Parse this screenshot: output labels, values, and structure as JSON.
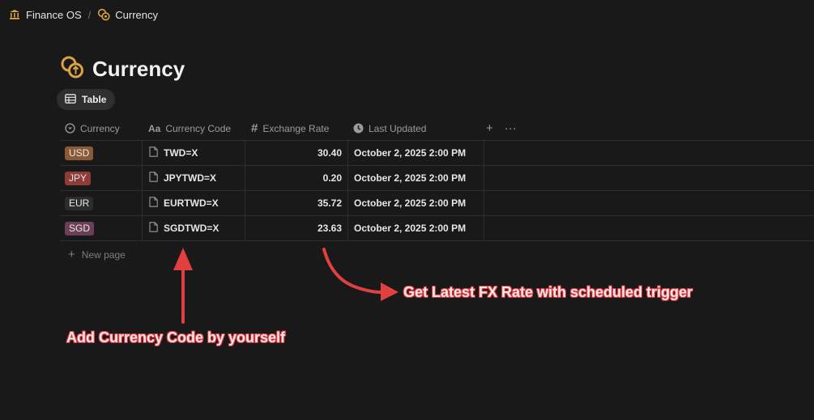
{
  "breadcrumb": {
    "workspace": "Finance OS",
    "separator": "/",
    "page": "Currency"
  },
  "page": {
    "title": "Currency"
  },
  "view_tab": {
    "label": "Table"
  },
  "columns": [
    {
      "label": "Currency",
      "icon": "select-icon"
    },
    {
      "label": "Currency Code",
      "icon": "text-aa-icon"
    },
    {
      "label": "Exchange Rate",
      "icon": "hash-icon"
    },
    {
      "label": "Last Updated",
      "icon": "clock-icon"
    }
  ],
  "header_actions": {
    "add": "+",
    "more": "···"
  },
  "rows": [
    {
      "currency": "USD",
      "code": "TWD=X",
      "rate": "30.40",
      "updated": "October 2, 2025 2:00 PM"
    },
    {
      "currency": "JPY",
      "code": "JPYTWD=X",
      "rate": "0.20",
      "updated": "October 2, 2025 2:00 PM"
    },
    {
      "currency": "EUR",
      "code": "EURTWD=X",
      "rate": "35.72",
      "updated": "October 2, 2025 2:00 PM"
    },
    {
      "currency": "SGD",
      "code": "SGDTWD=X",
      "rate": "23.63",
      "updated": "October 2, 2025 2:00 PM"
    }
  ],
  "tag_colors": {
    "USD": "#8a5a36",
    "JPY": "#8e3c37",
    "EUR": "#2c2c2c",
    "SGD": "#6b3f57"
  },
  "new_page": {
    "plus": "+",
    "label": "New page"
  },
  "annotations": {
    "code": "Add Currency Code by yourself",
    "rate": "Get Latest FX Rate with scheduled trigger",
    "arrow_color": "#e0403f"
  }
}
